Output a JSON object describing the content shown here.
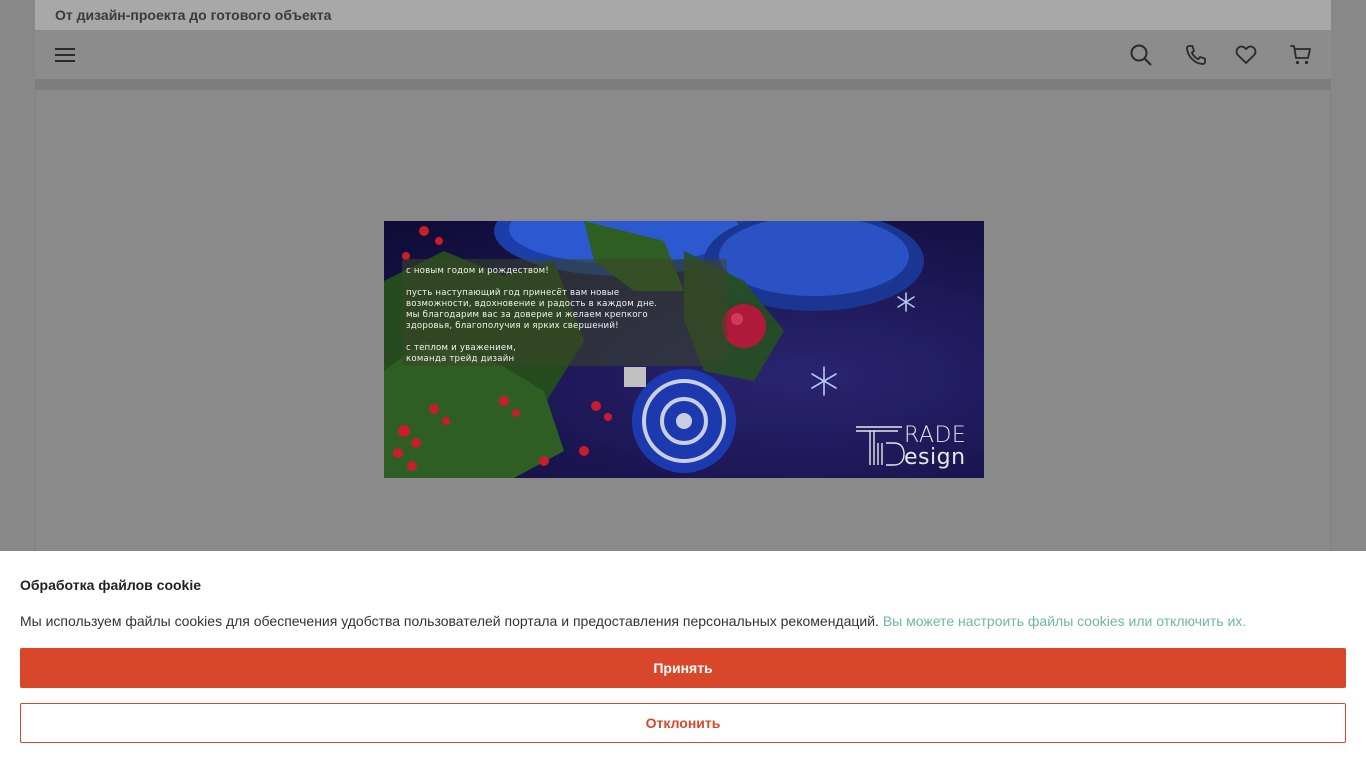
{
  "header": {
    "tagline": "От дизайн-проекта до готового объекта"
  },
  "nav": {
    "menu_icon": "hamburger-menu-icon",
    "icons": [
      "search-icon",
      "phone-icon",
      "heart-icon",
      "cart-icon"
    ]
  },
  "banner": {
    "greeting_title": "С Новым годом и Рождеством!",
    "greeting_body": [
      "Пусть наступающий год принесёт вам новые",
      "возможности, вдохновение и радость в каждом дне.",
      "Мы благодарим вас за доверие и желаем крепкого",
      "здоровья, благополучия и ярких свершений!"
    ],
    "signoff": [
      "С теплом и уважением,",
      "команда Трейд Дизайн"
    ],
    "logo_top": "RADE",
    "logo_bottom": "esign"
  },
  "cookie": {
    "title": "Обработка файлов cookie",
    "text": "Мы используем файлы cookies для обеспечения удобства пользователей портала и предоставления персональных рекомендаций.",
    "link": "Вы можете настроить файлы cookies или отключить их.",
    "accept_label": "Принять",
    "decline_label": "Отклонить"
  },
  "colors": {
    "accent": "#d9472b",
    "link": "#6fb6a6",
    "overlay": "#888888"
  }
}
